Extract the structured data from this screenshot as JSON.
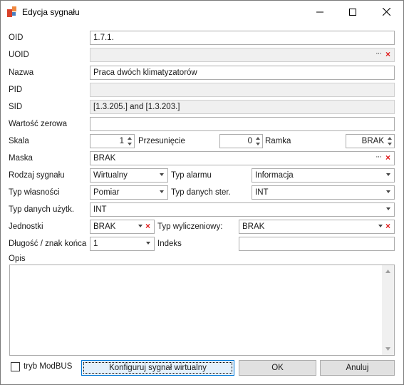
{
  "window": {
    "title": "Edycja sygnału"
  },
  "labels": {
    "oid": "OID",
    "uoid": "UOID",
    "nazwa": "Nazwa",
    "pid": "PID",
    "sid": "SID",
    "wartosc_zerowa": "Wartość zerowa",
    "skala": "Skala",
    "przesuniecie": "Przesunięcie",
    "ramka": "Ramka",
    "maska": "Maska",
    "rodzaj_sygnalu": "Rodzaj sygnału",
    "typ_alarmu": "Typ alarmu",
    "typ_wlasnosci": "Typ własności",
    "typ_danych_ster": "Typ danych ster.",
    "typ_danych_uzytk": "Typ danych użytk.",
    "jednostki": "Jednostki",
    "typ_wyliczeniowy": "Typ wyliczeniowy:",
    "dlugosc": "Długość / znak końca",
    "indeks": "Indeks",
    "opis": "Opis",
    "tryb_modbus": "tryb ModBUS"
  },
  "values": {
    "oid": "1.7.1.",
    "uoid": "",
    "nazwa": "Praca dwóch klimatyzatorów",
    "pid": "",
    "sid": "[1.3.205.] and [1.3.203.]",
    "wartosc_zerowa": "",
    "skala": "1",
    "przesuniecie": "0",
    "ramka": "BRAK",
    "maska": "BRAK",
    "rodzaj_sygnalu": "Wirtualny",
    "typ_alarmu": "Informacja",
    "typ_wlasnosci": "Pomiar",
    "typ_danych_ster": "INT",
    "typ_danych_uzytk": "INT",
    "jednostki": "BRAK",
    "typ_wyliczeniowy": "BRAK",
    "dlugosc": "1",
    "indeks": "",
    "opis": ""
  },
  "icons": {
    "ellipsis": "···",
    "clear": "×"
  },
  "buttons": {
    "konfiguruj": "Konfiguruj sygnał wirtualny",
    "ok": "OK",
    "anuluj": "Anuluj"
  },
  "colors": {
    "clear_red": "#e01a1a",
    "focus_blue": "#0078d7",
    "icon_orange": "#f0883e",
    "icon_red": "#d9412a"
  }
}
